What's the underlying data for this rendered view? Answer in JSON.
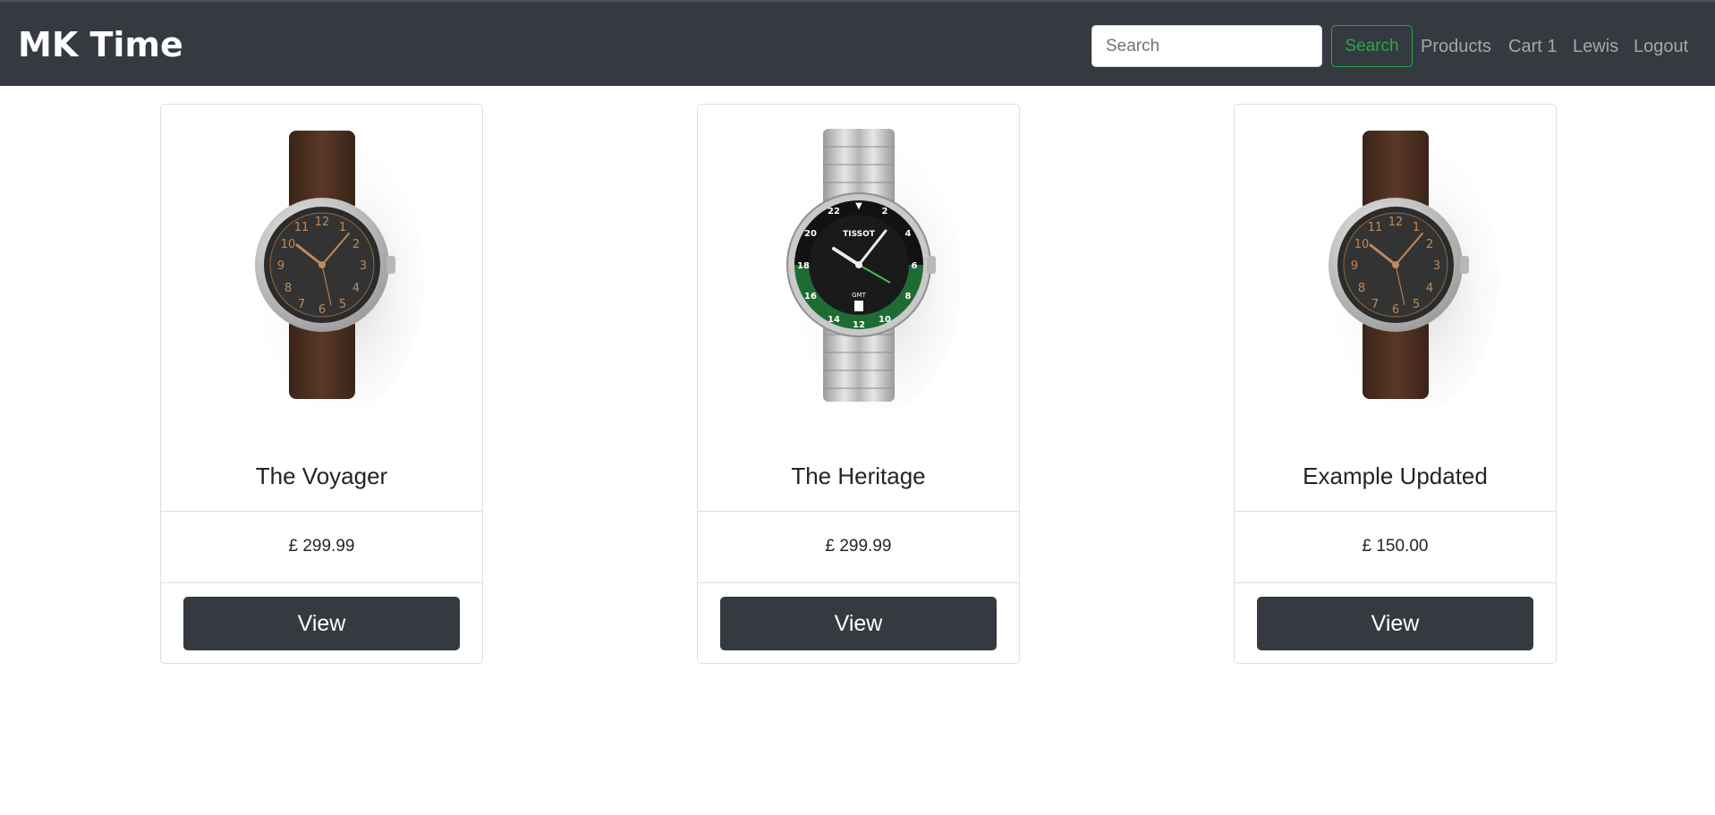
{
  "navbar": {
    "brand": "MK Time",
    "search_placeholder": "Search",
    "search_button": "Search",
    "links": [
      "Products",
      "Cart 1",
      "Lewis",
      "Logout"
    ]
  },
  "products": [
    {
      "name": "The Voyager",
      "price": "£ 299.99",
      "button": "View",
      "image": "watch-brown-leather-icon"
    },
    {
      "name": "The Heritage",
      "price": "£ 299.99",
      "button": "View",
      "image": "watch-steel-bracelet-gmt-icon"
    },
    {
      "name": "Example Updated",
      "price": "£ 150.00",
      "button": "View",
      "image": "watch-brown-leather-icon"
    }
  ],
  "colors": {
    "navbar_bg": "#343a40",
    "search_accent": "#28a745",
    "button_bg": "#343a40",
    "leather_strap": "#4a3022",
    "watch_bezel_green": "#1f6b34"
  }
}
